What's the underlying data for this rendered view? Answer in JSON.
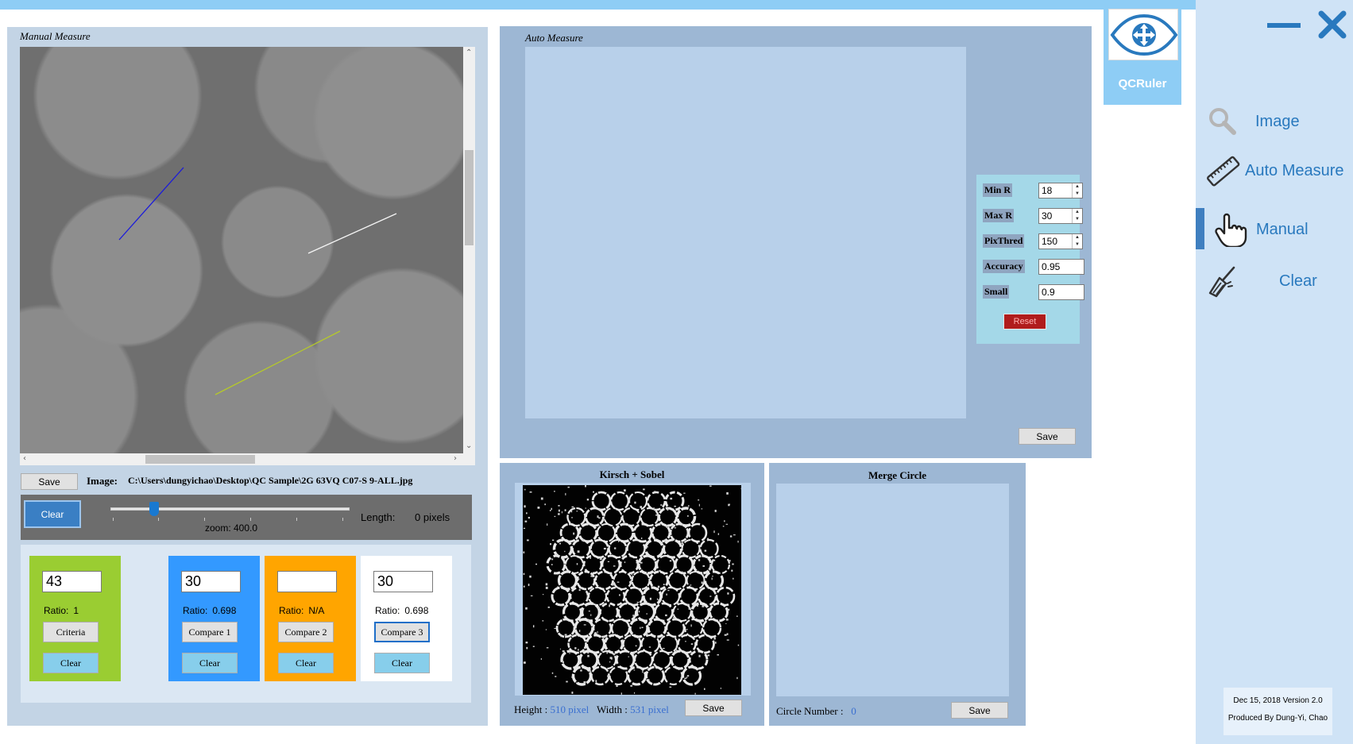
{
  "manual": {
    "title": "Manual Measure",
    "save_label": "Save",
    "image_label": "Image:",
    "image_path": "C:\\Users\\dungyichao\\Desktop\\QC Sample\\2G 63VQ C07-S 9-ALL.jpg",
    "clear_label": "Clear",
    "zoom_text": "zoom: 400.0",
    "zoom_value": 400.0,
    "length_label": "Length:",
    "length_value": "0 pixels"
  },
  "compare": [
    {
      "value": "43",
      "ratio_label": "Ratio:",
      "ratio_value": "1",
      "button": "Criteria",
      "clear": "Clear",
      "color": "#9acd32"
    },
    {
      "value": "30",
      "ratio_label": "Ratio:",
      "ratio_value": "0.698",
      "button": "Compare 1",
      "clear": "Clear",
      "color": "#3399ff"
    },
    {
      "value": "",
      "ratio_label": "Ratio:",
      "ratio_value": "N/A",
      "button": "Compare 2",
      "clear": "Clear",
      "color": "#ffa500"
    },
    {
      "value": "30",
      "ratio_label": "Ratio:",
      "ratio_value": "0.698",
      "button": "Compare 3",
      "clear": "Clear",
      "color": "#ffffff"
    }
  ],
  "auto": {
    "title": "Auto Measure",
    "params": [
      {
        "label": "Min R",
        "value": "18",
        "type": "spin"
      },
      {
        "label": "Max R",
        "value": "30",
        "type": "spin"
      },
      {
        "label": "PixThred",
        "value": "150",
        "type": "spin"
      },
      {
        "label": "Accuracy",
        "value": "0.95",
        "type": "text"
      },
      {
        "label": "Small",
        "value": "0.9",
        "type": "text"
      }
    ],
    "reset_label": "Reset",
    "save_label": "Save"
  },
  "kirsch": {
    "title": "Kirsch + Sobel",
    "height_label": "Height :",
    "height_value": "510",
    "width_label": "Width :",
    "width_value": "531",
    "unit": "pixel",
    "save_label": "Save"
  },
  "merge": {
    "title": "Merge Circle",
    "circle_label": "Circle Number :",
    "circle_value": "0",
    "save_label": "Save"
  },
  "brand": {
    "app_name": "QCRuler",
    "logo_icon": "logo-icon"
  },
  "sidebar": {
    "items": [
      {
        "label": "Image",
        "icon": "magnifier-icon"
      },
      {
        "label": "Auto Measure",
        "icon": "ruler-icon"
      },
      {
        "label": "Manual",
        "icon": "hand-pointer-icon",
        "active": true
      },
      {
        "label": "Clear",
        "icon": "broom-icon"
      }
    ],
    "version": "Dec 15, 2018 Version 2.0",
    "credit": "Produced By Dung-Yi, Chao"
  },
  "colors": {
    "accent": "#2979be",
    "topbar": "#8ecdf5",
    "panel": "#9db7d4",
    "reset": "#b01c1c"
  }
}
